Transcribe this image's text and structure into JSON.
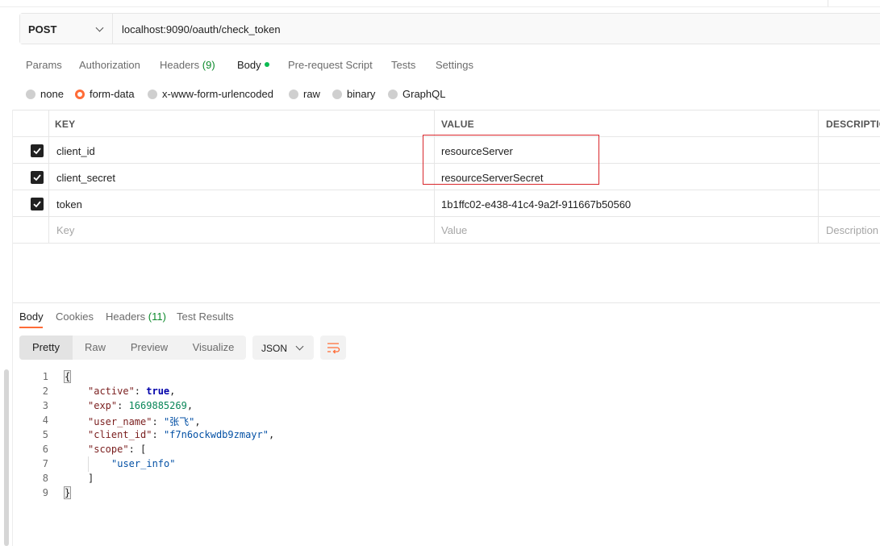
{
  "request": {
    "method": "POST",
    "url": "localhost:9090/oauth/check_token",
    "tabs": [
      {
        "label": "Params"
      },
      {
        "label": "Authorization"
      },
      {
        "label": "Headers",
        "count": "(9)"
      },
      {
        "label": "Body",
        "active": true
      },
      {
        "label": "Pre-request Script"
      },
      {
        "label": "Tests"
      },
      {
        "label": "Settings"
      }
    ],
    "body_types": [
      "none",
      "form-data",
      "x-www-form-urlencoded",
      "raw",
      "binary",
      "GraphQL"
    ],
    "body_type_selected": "form-data"
  },
  "params_table": {
    "headers": {
      "key": "KEY",
      "value": "VALUE",
      "description": "DESCRIPTIO"
    },
    "rows": [
      {
        "checked": true,
        "key": "client_id",
        "value": "resourceServer"
      },
      {
        "checked": true,
        "key": "client_secret",
        "value": "resourceServerSecret"
      },
      {
        "checked": true,
        "key": "token",
        "value": "1b1ffc02-e438-41c4-9a2f-911667b50560"
      }
    ],
    "placeholders": {
      "key": "Key",
      "value": "Value",
      "description": "Description"
    }
  },
  "response": {
    "tabs": [
      {
        "label": "Body",
        "active": true
      },
      {
        "label": "Cookies"
      },
      {
        "label": "Headers",
        "count": "(11)"
      },
      {
        "label": "Test Results"
      }
    ],
    "view_modes": [
      "Pretty",
      "Raw",
      "Preview",
      "Visualize"
    ],
    "view_selected": "Pretty",
    "format": "JSON",
    "code_lines": [
      {
        "n": "1",
        "text": "{"
      },
      {
        "n": "2",
        "key": "\"active\"",
        "value": "true",
        "type": "bool",
        "suffix": ","
      },
      {
        "n": "3",
        "key": "\"exp\"",
        "value": "1669885269",
        "type": "num",
        "suffix": ","
      },
      {
        "n": "4",
        "key": "\"user_name\"",
        "value": "\"张飞\"",
        "type": "str",
        "suffix": ","
      },
      {
        "n": "5",
        "key": "\"client_id\"",
        "value": "\"f7n6ockwdb9zmayr\"",
        "type": "str",
        "suffix": ","
      },
      {
        "n": "6",
        "key": "\"scope\"",
        "value": "[",
        "type": "plain",
        "suffix": ""
      },
      {
        "n": "7",
        "value": "\"user_info\"",
        "type": "str"
      },
      {
        "n": "8",
        "text": "]"
      },
      {
        "n": "9",
        "text": "}"
      }
    ]
  },
  "colors": {
    "accent": "#ff6c37",
    "green": "#0cbb52",
    "highlight_box": "#d9262b"
  }
}
